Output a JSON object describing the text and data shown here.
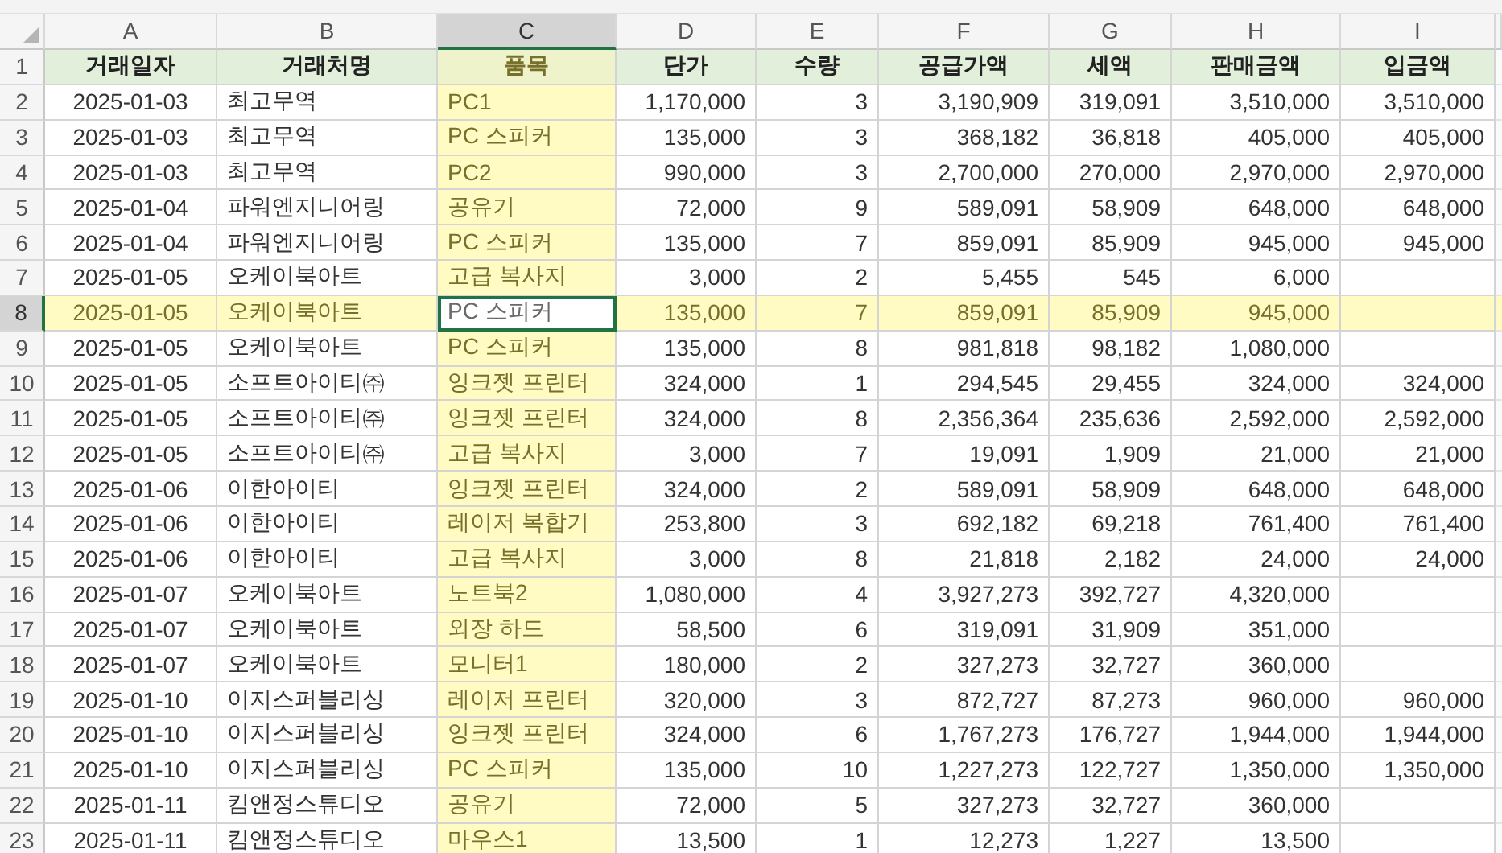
{
  "columns": [
    {
      "label": "A",
      "selected": false
    },
    {
      "label": "B",
      "selected": false
    },
    {
      "label": "C",
      "selected": true
    },
    {
      "label": "D",
      "selected": false
    },
    {
      "label": "E",
      "selected": false
    },
    {
      "label": "F",
      "selected": false
    },
    {
      "label": "G",
      "selected": false
    },
    {
      "label": "H",
      "selected": false
    },
    {
      "label": "I",
      "selected": false
    }
  ],
  "header_row": {
    "number": "1",
    "cells": [
      "거래일자",
      "거래처명",
      "품목",
      "단가",
      "수량",
      "공급가액",
      "세액",
      "판매금액",
      "입금액"
    ]
  },
  "rows": [
    {
      "number": "2",
      "selected": false,
      "cells": [
        "2025-01-03",
        "최고무역",
        "PC1",
        "1,170,000",
        "3",
        "3,190,909",
        "319,091",
        "3,510,000",
        "3,510,000"
      ]
    },
    {
      "number": "3",
      "selected": false,
      "cells": [
        "2025-01-03",
        "최고무역",
        "PC 스피커",
        "135,000",
        "3",
        "368,182",
        "36,818",
        "405,000",
        "405,000"
      ]
    },
    {
      "number": "4",
      "selected": false,
      "cells": [
        "2025-01-03",
        "최고무역",
        "PC2",
        "990,000",
        "3",
        "2,700,000",
        "270,000",
        "2,970,000",
        "2,970,000"
      ]
    },
    {
      "number": "5",
      "selected": false,
      "cells": [
        "2025-01-04",
        "파워엔지니어링",
        "공유기",
        "72,000",
        "9",
        "589,091",
        "58,909",
        "648,000",
        "648,000"
      ]
    },
    {
      "number": "6",
      "selected": false,
      "cells": [
        "2025-01-04",
        "파워엔지니어링",
        "PC 스피커",
        "135,000",
        "7",
        "859,091",
        "85,909",
        "945,000",
        "945,000"
      ]
    },
    {
      "number": "7",
      "selected": false,
      "cells": [
        "2025-01-05",
        "오케이북아트",
        "고급 복사지",
        "3,000",
        "2",
        "5,455",
        "545",
        "6,000"
      ]
    },
    {
      "number": "8",
      "selected": true,
      "cells": [
        "2025-01-05",
        "오케이북아트",
        "PC 스피커",
        "135,000",
        "7",
        "859,091",
        "85,909",
        "945,000"
      ]
    },
    {
      "number": "9",
      "selected": false,
      "cells": [
        "2025-01-05",
        "오케이북아트",
        "PC 스피커",
        "135,000",
        "8",
        "981,818",
        "98,182",
        "1,080,000"
      ]
    },
    {
      "number": "10",
      "selected": false,
      "cells": [
        "2025-01-05",
        "소프트아이티㈜",
        "잉크젯 프린터",
        "324,000",
        "1",
        "294,545",
        "29,455",
        "324,000",
        "324,000"
      ]
    },
    {
      "number": "11",
      "selected": false,
      "cells": [
        "2025-01-05",
        "소프트아이티㈜",
        "잉크젯 프린터",
        "324,000",
        "8",
        "2,356,364",
        "235,636",
        "2,592,000",
        "2,592,000"
      ]
    },
    {
      "number": "12",
      "selected": false,
      "cells": [
        "2025-01-05",
        "소프트아이티㈜",
        "고급 복사지",
        "3,000",
        "7",
        "19,091",
        "1,909",
        "21,000",
        "21,000"
      ]
    },
    {
      "number": "13",
      "selected": false,
      "cells": [
        "2025-01-06",
        "이한아이티",
        "잉크젯 프린터",
        "324,000",
        "2",
        "589,091",
        "58,909",
        "648,000",
        "648,000"
      ]
    },
    {
      "number": "14",
      "selected": false,
      "cells": [
        "2025-01-06",
        "이한아이티",
        "레이저 복합기",
        "253,800",
        "3",
        "692,182",
        "69,218",
        "761,400",
        "761,400"
      ]
    },
    {
      "number": "15",
      "selected": false,
      "cells": [
        "2025-01-06",
        "이한아이티",
        "고급 복사지",
        "3,000",
        "8",
        "21,818",
        "2,182",
        "24,000",
        "24,000"
      ]
    },
    {
      "number": "16",
      "selected": false,
      "cells": [
        "2025-01-07",
        "오케이북아트",
        "노트북2",
        "1,080,000",
        "4",
        "3,927,273",
        "392,727",
        "4,320,000"
      ]
    },
    {
      "number": "17",
      "selected": false,
      "cells": [
        "2025-01-07",
        "오케이북아트",
        "외장 하드",
        "58,500",
        "6",
        "319,091",
        "31,909",
        "351,000"
      ]
    },
    {
      "number": "18",
      "selected": false,
      "cells": [
        "2025-01-07",
        "오케이북아트",
        "모니터1",
        "180,000",
        "2",
        "327,273",
        "32,727",
        "360,000"
      ]
    },
    {
      "number": "19",
      "selected": false,
      "cells": [
        "2025-01-10",
        "이지스퍼블리싱",
        "레이저 프린터",
        "320,000",
        "3",
        "872,727",
        "87,273",
        "960,000",
        "960,000"
      ]
    },
    {
      "number": "20",
      "selected": false,
      "cells": [
        "2025-01-10",
        "이지스퍼블리싱",
        "잉크젯 프린터",
        "324,000",
        "6",
        "1,767,273",
        "176,727",
        "1,944,000",
        "1,944,000"
      ]
    },
    {
      "number": "21",
      "selected": false,
      "cells": [
        "2025-01-10",
        "이지스퍼블리싱",
        "PC 스피커",
        "135,000",
        "10",
        "1,227,273",
        "122,727",
        "1,350,000",
        "1,350,000"
      ]
    },
    {
      "number": "22",
      "selected": false,
      "cells": [
        "2025-01-11",
        "킴앤정스튜디오",
        "공유기",
        "72,000",
        "5",
        "327,273",
        "32,727",
        "360,000"
      ]
    },
    {
      "number": "23",
      "selected": false,
      "cells": [
        "2025-01-11",
        "킴앤정스튜디오",
        "마우스1",
        "13,500",
        "1",
        "12,273",
        "1,227",
        "13,500"
      ]
    }
  ]
}
